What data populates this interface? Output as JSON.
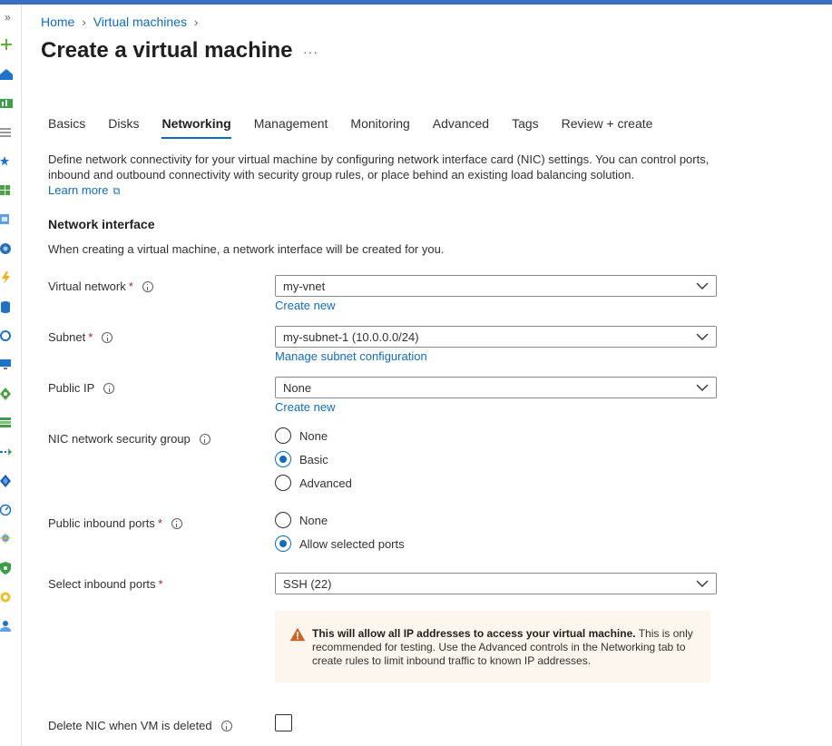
{
  "breadcrumb": {
    "home": "Home",
    "vms": "Virtual machines"
  },
  "page_title": "Create a virtual machine",
  "more_actions": "···",
  "tabs": [
    "Basics",
    "Disks",
    "Networking",
    "Management",
    "Monitoring",
    "Advanced",
    "Tags",
    "Review + create"
  ],
  "active_tab": "Networking",
  "description": "Define network connectivity for your virtual machine by configuring network interface card (NIC) settings. You can control ports, inbound and outbound connectivity with security group rules, or place behind an existing load balancing solution.",
  "learn_more": "Learn more",
  "section": {
    "heading": "Network interface",
    "subtext": "When creating a virtual machine, a network interface will be created for you."
  },
  "fields": {
    "vnet": {
      "label": "Virtual network",
      "value": "my-vnet",
      "link": "Create new"
    },
    "subnet": {
      "label": "Subnet",
      "value": "my-subnet-1 (10.0.0.0/24)",
      "link": "Manage subnet configuration"
    },
    "public_ip": {
      "label": "Public IP",
      "value": "None",
      "link": "Create new"
    },
    "nsg": {
      "label": "NIC network security group",
      "options": [
        "None",
        "Basic",
        "Advanced"
      ],
      "selected": "Basic"
    },
    "inbound": {
      "label": "Public inbound ports",
      "options": [
        "None",
        "Allow selected ports"
      ],
      "selected": "Allow selected ports"
    },
    "select_ports": {
      "label": "Select inbound ports",
      "value": "SSH (22)"
    },
    "delete_nic": {
      "label": "Delete NIC when VM is deleted",
      "checked": false
    }
  },
  "warning": {
    "bold": "This will allow all IP addresses to access your virtual machine.",
    "text": " This is only recommended for testing.  Use the Advanced controls in the Networking tab to create rules to limit inbound traffic to known IP addresses."
  },
  "colors": {
    "accent": "#0f6cbd",
    "warning_bg": "#fdf6ee",
    "warning_icon": "#c8652a",
    "required": "#a4262c",
    "top_bar": "#3a6fc4"
  }
}
